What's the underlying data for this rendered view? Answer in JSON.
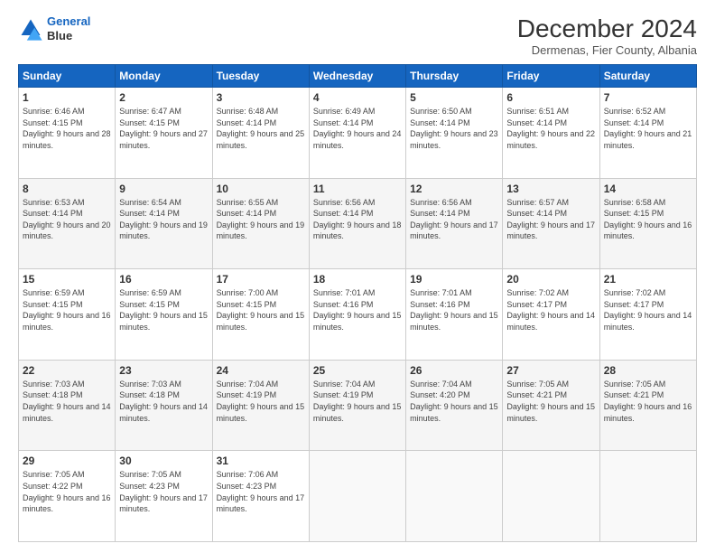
{
  "header": {
    "logo_line1": "General",
    "logo_line2": "Blue",
    "month_title": "December 2024",
    "subtitle": "Dermenas, Fier County, Albania"
  },
  "weekdays": [
    "Sunday",
    "Monday",
    "Tuesday",
    "Wednesday",
    "Thursday",
    "Friday",
    "Saturday"
  ],
  "weeks": [
    [
      {
        "day": "1",
        "sunrise": "6:46 AM",
        "sunset": "4:15 PM",
        "daylight": "9 hours and 28 minutes."
      },
      {
        "day": "2",
        "sunrise": "6:47 AM",
        "sunset": "4:15 PM",
        "daylight": "9 hours and 27 minutes."
      },
      {
        "day": "3",
        "sunrise": "6:48 AM",
        "sunset": "4:14 PM",
        "daylight": "9 hours and 25 minutes."
      },
      {
        "day": "4",
        "sunrise": "6:49 AM",
        "sunset": "4:14 PM",
        "daylight": "9 hours and 24 minutes."
      },
      {
        "day": "5",
        "sunrise": "6:50 AM",
        "sunset": "4:14 PM",
        "daylight": "9 hours and 23 minutes."
      },
      {
        "day": "6",
        "sunrise": "6:51 AM",
        "sunset": "4:14 PM",
        "daylight": "9 hours and 22 minutes."
      },
      {
        "day": "7",
        "sunrise": "6:52 AM",
        "sunset": "4:14 PM",
        "daylight": "9 hours and 21 minutes."
      }
    ],
    [
      {
        "day": "8",
        "sunrise": "6:53 AM",
        "sunset": "4:14 PM",
        "daylight": "9 hours and 20 minutes."
      },
      {
        "day": "9",
        "sunrise": "6:54 AM",
        "sunset": "4:14 PM",
        "daylight": "9 hours and 19 minutes."
      },
      {
        "day": "10",
        "sunrise": "6:55 AM",
        "sunset": "4:14 PM",
        "daylight": "9 hours and 19 minutes."
      },
      {
        "day": "11",
        "sunrise": "6:56 AM",
        "sunset": "4:14 PM",
        "daylight": "9 hours and 18 minutes."
      },
      {
        "day": "12",
        "sunrise": "6:56 AM",
        "sunset": "4:14 PM",
        "daylight": "9 hours and 17 minutes."
      },
      {
        "day": "13",
        "sunrise": "6:57 AM",
        "sunset": "4:14 PM",
        "daylight": "9 hours and 17 minutes."
      },
      {
        "day": "14",
        "sunrise": "6:58 AM",
        "sunset": "4:15 PM",
        "daylight": "9 hours and 16 minutes."
      }
    ],
    [
      {
        "day": "15",
        "sunrise": "6:59 AM",
        "sunset": "4:15 PM",
        "daylight": "9 hours and 16 minutes."
      },
      {
        "day": "16",
        "sunrise": "6:59 AM",
        "sunset": "4:15 PM",
        "daylight": "9 hours and 15 minutes."
      },
      {
        "day": "17",
        "sunrise": "7:00 AM",
        "sunset": "4:15 PM",
        "daylight": "9 hours and 15 minutes."
      },
      {
        "day": "18",
        "sunrise": "7:01 AM",
        "sunset": "4:16 PM",
        "daylight": "9 hours and 15 minutes."
      },
      {
        "day": "19",
        "sunrise": "7:01 AM",
        "sunset": "4:16 PM",
        "daylight": "9 hours and 15 minutes."
      },
      {
        "day": "20",
        "sunrise": "7:02 AM",
        "sunset": "4:17 PM",
        "daylight": "9 hours and 14 minutes."
      },
      {
        "day": "21",
        "sunrise": "7:02 AM",
        "sunset": "4:17 PM",
        "daylight": "9 hours and 14 minutes."
      }
    ],
    [
      {
        "day": "22",
        "sunrise": "7:03 AM",
        "sunset": "4:18 PM",
        "daylight": "9 hours and 14 minutes."
      },
      {
        "day": "23",
        "sunrise": "7:03 AM",
        "sunset": "4:18 PM",
        "daylight": "9 hours and 14 minutes."
      },
      {
        "day": "24",
        "sunrise": "7:04 AM",
        "sunset": "4:19 PM",
        "daylight": "9 hours and 15 minutes."
      },
      {
        "day": "25",
        "sunrise": "7:04 AM",
        "sunset": "4:19 PM",
        "daylight": "9 hours and 15 minutes."
      },
      {
        "day": "26",
        "sunrise": "7:04 AM",
        "sunset": "4:20 PM",
        "daylight": "9 hours and 15 minutes."
      },
      {
        "day": "27",
        "sunrise": "7:05 AM",
        "sunset": "4:21 PM",
        "daylight": "9 hours and 15 minutes."
      },
      {
        "day": "28",
        "sunrise": "7:05 AM",
        "sunset": "4:21 PM",
        "daylight": "9 hours and 16 minutes."
      }
    ],
    [
      {
        "day": "29",
        "sunrise": "7:05 AM",
        "sunset": "4:22 PM",
        "daylight": "9 hours and 16 minutes."
      },
      {
        "day": "30",
        "sunrise": "7:05 AM",
        "sunset": "4:23 PM",
        "daylight": "9 hours and 17 minutes."
      },
      {
        "day": "31",
        "sunrise": "7:06 AM",
        "sunset": "4:23 PM",
        "daylight": "9 hours and 17 minutes."
      },
      null,
      null,
      null,
      null
    ]
  ]
}
